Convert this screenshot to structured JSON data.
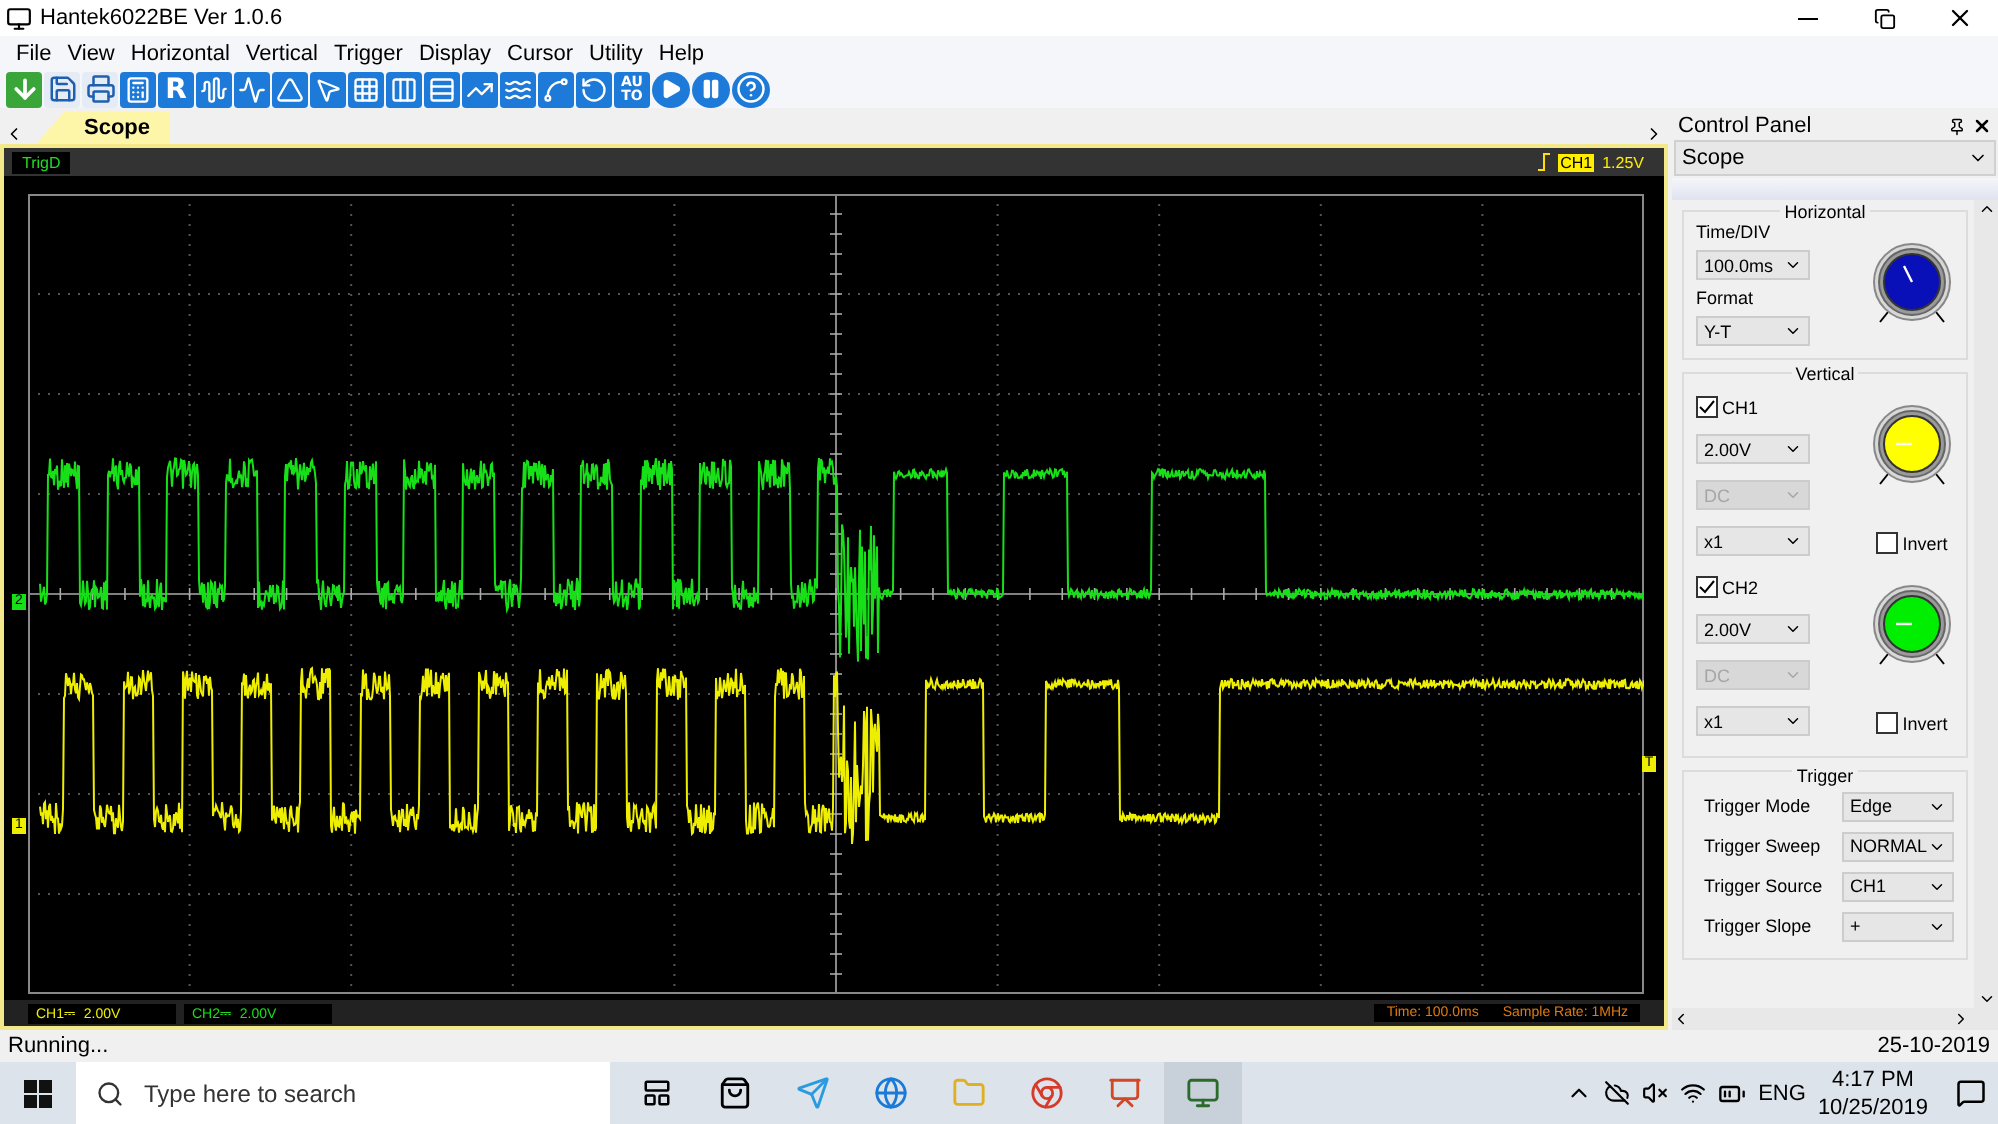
{
  "window": {
    "title": "Hantek6022BE Ver 1.0.6"
  },
  "menu": [
    "File",
    "View",
    "Horizontal",
    "Vertical",
    "Trigger",
    "Display",
    "Cursor",
    "Utility",
    "Help"
  ],
  "toolbar": {
    "r_label": "R",
    "auto_label": [
      "AU",
      "TO"
    ]
  },
  "tabs": [
    {
      "label": "Scope",
      "selected": true
    }
  ],
  "scope": {
    "trig_status": "TrigD",
    "trigger_source": "CH1",
    "trigger_level": "1.25V",
    "trigger_marker": "T",
    "channels": [
      {
        "marker": "2",
        "color": "#18e018"
      },
      {
        "marker": "1",
        "color": "#eeee00"
      }
    ],
    "footer": [
      "CH1⎓  2.00V",
      "CH2⎓  2.00V"
    ],
    "time": "Time: 100.0ms",
    "sample_rate": "Sample Rate: 1MHz"
  },
  "control_panel": {
    "title": "Control Panel",
    "mode": "Scope",
    "horizontal": {
      "title": "Horizontal",
      "time_div_label": "Time/DIV",
      "time_div": "100.0ms",
      "format_label": "Format",
      "format": "Y-T"
    },
    "vertical": {
      "title": "Vertical",
      "channels": [
        {
          "name": "CH1",
          "checked": true,
          "volts": "2.00V",
          "coupling": "DC",
          "coupling_disabled": true,
          "probe": "x1",
          "invert_label": "Invert",
          "invert": false,
          "color": "#ffff00"
        },
        {
          "name": "CH2",
          "checked": true,
          "volts": "2.00V",
          "coupling": "DC",
          "coupling_disabled": true,
          "probe": "x1",
          "invert_label": "Invert",
          "invert": false,
          "color": "#00ee00"
        }
      ]
    },
    "trigger": {
      "title": "Trigger",
      "rows": [
        {
          "label": "Trigger Mode",
          "value": "Edge"
        },
        {
          "label": "Trigger Sweep",
          "value": "NORMAL"
        },
        {
          "label": "Trigger Source",
          "value": "CH1"
        },
        {
          "label": "Trigger Slope",
          "value": "+"
        }
      ]
    }
  },
  "status_bar": {
    "text": "Running...",
    "date": "25-10-2019"
  },
  "taskbar": {
    "search_placeholder": "Type here to search",
    "language": "ENG",
    "time": "4:17 PM",
    "date": "10/25/2019"
  }
}
